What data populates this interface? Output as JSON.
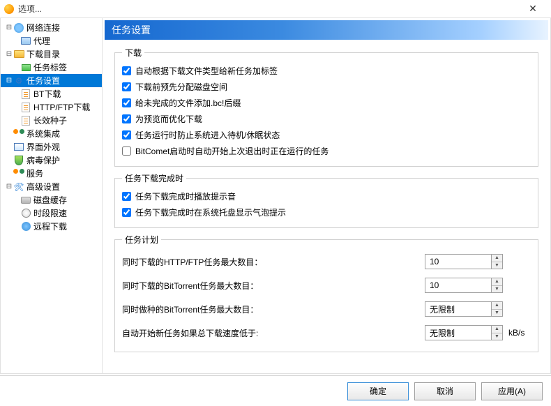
{
  "window": {
    "title": "选项..."
  },
  "sidebar": {
    "items": [
      {
        "label": "网络连接",
        "children": [
          {
            "label": "代理"
          }
        ]
      },
      {
        "label": "下载目录",
        "children": [
          {
            "label": "任务标签"
          }
        ]
      },
      {
        "label": "任务设置",
        "children": [
          {
            "label": "BT下载"
          },
          {
            "label": "HTTP/FTP下载"
          },
          {
            "label": "长效种子"
          }
        ]
      },
      {
        "label": "系统集成"
      },
      {
        "label": "界面外观"
      },
      {
        "label": "病毒保护"
      },
      {
        "label": "服务"
      },
      {
        "label": "高级设置",
        "children": [
          {
            "label": "磁盘缓存"
          },
          {
            "label": "时段限速"
          },
          {
            "label": "远程下载"
          }
        ]
      }
    ]
  },
  "panel": {
    "title": "任务设置",
    "groups": {
      "download": {
        "legend": "下载",
        "chk": [
          {
            "label": "自动根据下载文件类型给新任务加标签",
            "checked": true
          },
          {
            "label": "下载前预先分配磁盘空间",
            "checked": true
          },
          {
            "label": "给未完成的文件添加.bc!后缀",
            "checked": true
          },
          {
            "label": "为预览而优化下载",
            "checked": true
          },
          {
            "label": "任务运行时防止系统进入待机/休眠状态",
            "checked": true
          },
          {
            "label": "BitComet启动时自动开始上次退出时正在运行的任务",
            "checked": false
          }
        ]
      },
      "complete": {
        "legend": "任务下载完成时",
        "chk": [
          {
            "label": "任务下载完成时播放提示音",
            "checked": true
          },
          {
            "label": "任务下载完成时在系统托盘显示气泡提示",
            "checked": true
          }
        ]
      },
      "schedule": {
        "legend": "任务计划",
        "fields": [
          {
            "label": "同时下载的HTTP/FTP任务最大数目：",
            "value": "10",
            "unit": ""
          },
          {
            "label": "同时下载的BitTorrent任务最大数目：",
            "value": "10",
            "unit": ""
          },
          {
            "label": "同时做种的BitTorrent任务最大数目：",
            "value": "无限制",
            "unit": ""
          },
          {
            "label": "自动开始新任务如果总下载速度低于:",
            "value": "无限制",
            "unit": "kB/s"
          }
        ]
      }
    }
  },
  "footer": {
    "ok": "确定",
    "cancel": "取消",
    "apply": "应用(A)"
  }
}
